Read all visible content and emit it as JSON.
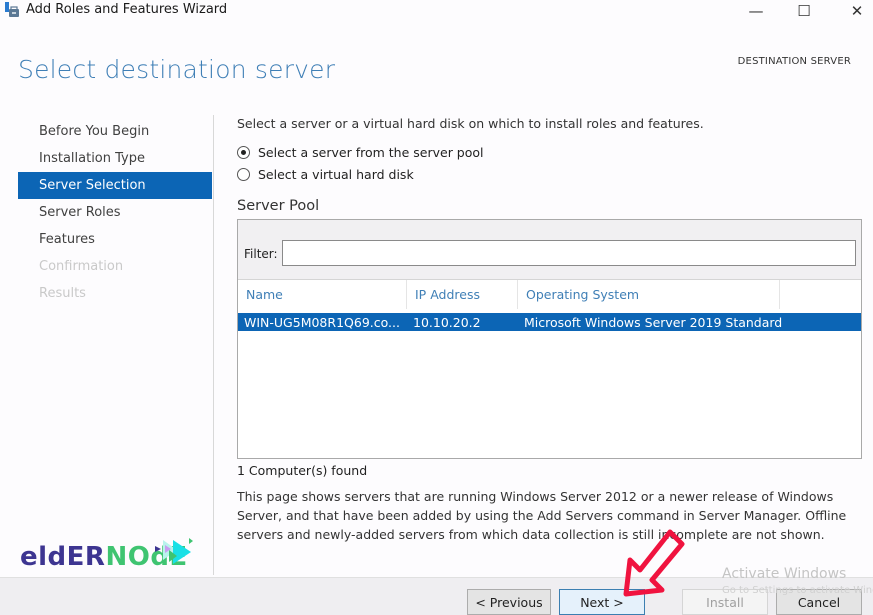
{
  "window": {
    "title": "Add Roles and Features Wizard",
    "controls": {
      "minimize": "—",
      "maximize": "☐",
      "close": "✕"
    }
  },
  "header": {
    "page_title": "Select destination server",
    "destination_label": "DESTINATION SERVER"
  },
  "sidebar": {
    "items": [
      {
        "label": "Before You Begin",
        "state": "normal"
      },
      {
        "label": "Installation Type",
        "state": "normal"
      },
      {
        "label": "Server Selection",
        "state": "active"
      },
      {
        "label": "Server Roles",
        "state": "normal"
      },
      {
        "label": "Features",
        "state": "normal"
      },
      {
        "label": "Confirmation",
        "state": "disabled"
      },
      {
        "label": "Results",
        "state": "disabled"
      }
    ]
  },
  "main": {
    "intro": "Select a server or a virtual hard disk on which to install roles and features.",
    "options": [
      {
        "label": "Select a server from the server pool",
        "selected": true
      },
      {
        "label": "Select a virtual hard disk",
        "selected": false
      }
    ],
    "pool_label": "Server Pool",
    "filter": {
      "label": "Filter:",
      "value": "",
      "placeholder": ""
    },
    "columns": [
      "Name",
      "IP Address",
      "Operating System"
    ],
    "rows": [
      {
        "name": "WIN-UG5M08R1Q69.co...",
        "ip": "10.10.20.2",
        "os": "Microsoft Windows Server 2019 Standard",
        "selected": true
      }
    ],
    "found_count": "1 Computer(s) found",
    "description": "This page shows servers that are running Windows Server 2012 or a newer release of Windows Server, and that have been added by using the Add Servers command in Server Manager. Offline servers and newly-added servers from which data collection is still incomplete are not shown."
  },
  "footer": {
    "previous": "< Previous",
    "next": "Next >",
    "install": "Install",
    "cancel": "Cancel"
  },
  "overlay": {
    "watermark_title": "Activate Windows",
    "watermark_sub": "Go to Settings to activate Windows.",
    "logo_part1": "eldER",
    "logo_part2": "NOdE",
    "colors": {
      "accent": "#0c65b5",
      "title_blue": "#3f7fb6",
      "arrow": "#f0133f",
      "logo_purple": "#3d3591",
      "logo_green": "#3fc471"
    }
  }
}
